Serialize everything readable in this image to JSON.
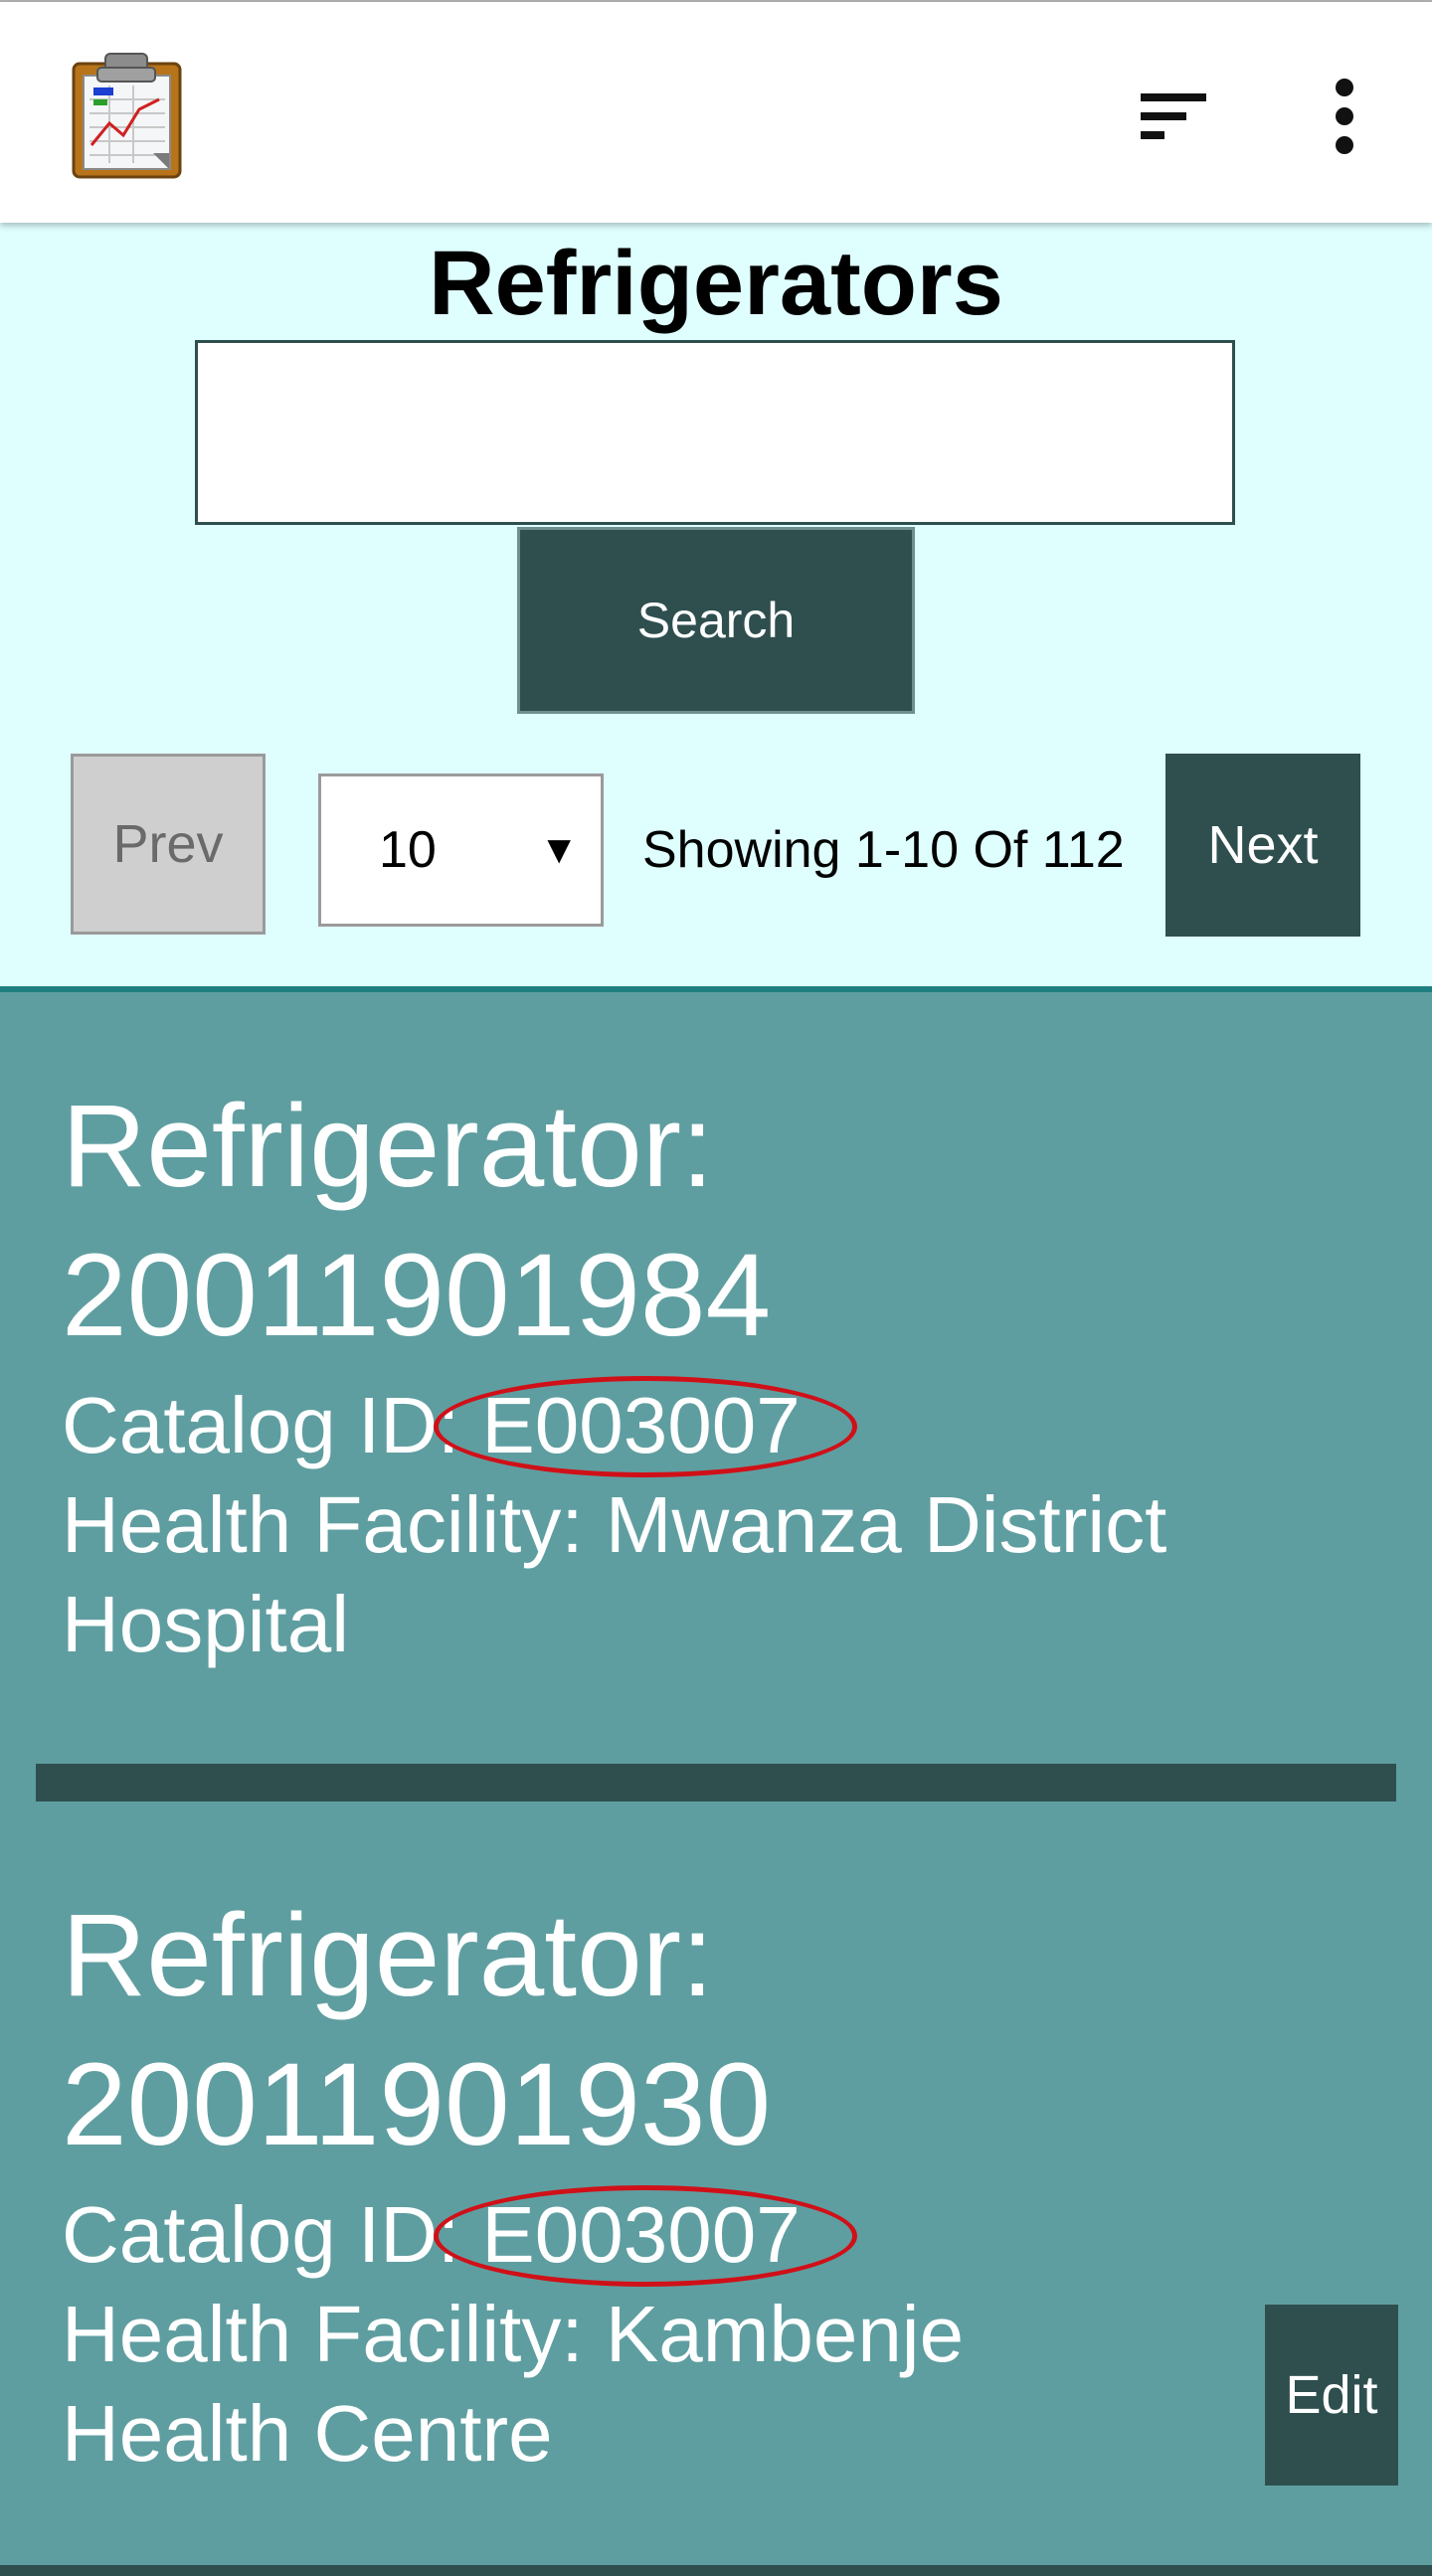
{
  "app": {
    "logo_icon": "clipboard-chart-icon",
    "sort_icon": "sort-lines-icon",
    "more_icon": "more-vertical-icon"
  },
  "page": {
    "title": "Refrigerators"
  },
  "search": {
    "value": "",
    "button_label": "Search"
  },
  "pagination": {
    "prev_label": "Prev",
    "page_size": "10",
    "showing": "Showing 1-10 Of 112",
    "next_label": "Next"
  },
  "records": [
    {
      "title_line1": "Refrigerator:",
      "title_line2": "20011901984",
      "catalog_label": "Catalog ID: ",
      "catalog_id": "E003007",
      "facility_line1": "Health Facility: Mwanza District",
      "facility_line2": "Hospital"
    },
    {
      "title_line1": "Refrigerator:",
      "title_line2": "20011901930",
      "catalog_label": "Catalog ID: ",
      "catalog_id": "E003007",
      "facility_line1": "Health Facility: Kambenje",
      "facility_line2": "Health Centre",
      "edit_label": "Edit"
    }
  ],
  "colors": {
    "header_bg": "#ffffff",
    "panel_bg": "#dfffff",
    "list_bg": "#5f9ea0",
    "dark_accent": "#2f4f4f",
    "annotation": "#d01018"
  }
}
